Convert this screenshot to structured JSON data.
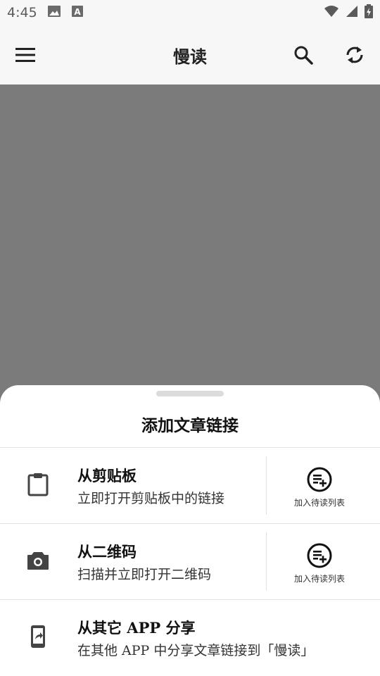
{
  "status_bar": {
    "time": "4:45",
    "icons": [
      "image-icon",
      "font-a-icon",
      "wifi-icon",
      "signal-icon",
      "battery-charging-icon"
    ]
  },
  "app_bar": {
    "title": "慢读",
    "icons": [
      "menu-icon",
      "search-icon",
      "sync-icon"
    ]
  },
  "sheet": {
    "title": "添加文章链接",
    "options": [
      {
        "icon": "clipboard-icon",
        "title": "从剪贴板",
        "subtitle": "立即打开剪贴板中的链接",
        "queue_label": "加入待读列表"
      },
      {
        "icon": "camera-icon",
        "title": "从二维码",
        "subtitle": "扫描并立即打开二维码",
        "queue_label": "加入待读列表"
      },
      {
        "icon": "share-phone-icon",
        "title": "从其它 APP 分享",
        "subtitle": "在其他 APP 中分享文章链接到「慢读」"
      }
    ]
  },
  "colors": {
    "scrim": "#7b7b7b",
    "sheet": "#ffffff",
    "text_primary": "#111111",
    "icon": "#444444"
  }
}
